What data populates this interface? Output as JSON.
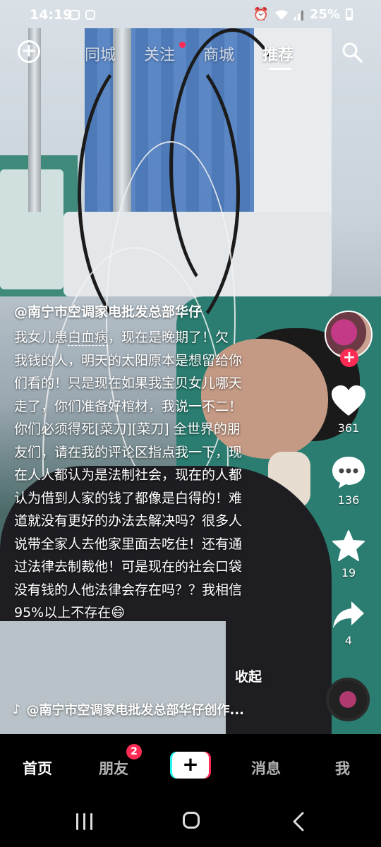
{
  "status_bar": {
    "time": "14:19",
    "battery": "25%"
  },
  "top_nav": {
    "tabs": [
      {
        "label": "同城",
        "active": false
      },
      {
        "label": "关注",
        "active": false,
        "has_dot": true
      },
      {
        "label": "商城",
        "active": false
      },
      {
        "label": "推荐",
        "active": true
      }
    ]
  },
  "video": {
    "author": "@南宁市空调家电批发总部华仔",
    "caption_lines": [
      "我女儿患白血病，现在是晚期了！欠",
      "我钱的人，明天的太阳原本是想留给你",
      "们看的！只是现在如果我宝贝女儿哪天",
      "走了，你们准备好棺材，我说一不二！",
      "你们必须得死[菜刀][菜刀] 全世界的朋",
      "友们，请在我的评论区指点我一下，现",
      "在人人都认为是法制社会，现在的人都",
      "认为借到人家的钱了都像是白得的！难",
      "道就没有更好的办法去解决吗？很多人",
      "说带全家人去他家里面去吃住！还有通",
      "过法律去制裁他！可是现在的社会口袋",
      "没有钱的人他法律会存在吗？？我相信",
      "95%以上不存在😄"
    ],
    "caption_highlight": "白血病",
    "collapse_label": "收起",
    "music_text": "@南宁市空调家电批发总部华仔创作..."
  },
  "rail": {
    "likes": "361",
    "comments": "136",
    "favorites": "19",
    "shares": "4"
  },
  "bottom_nav": {
    "items": [
      "首页",
      "朋友",
      "消息",
      "我"
    ],
    "friends_badge": "2",
    "create_label": "+"
  },
  "colors": {
    "accent_red": "#fe2c55",
    "accent_cyan": "#25f4ee"
  }
}
